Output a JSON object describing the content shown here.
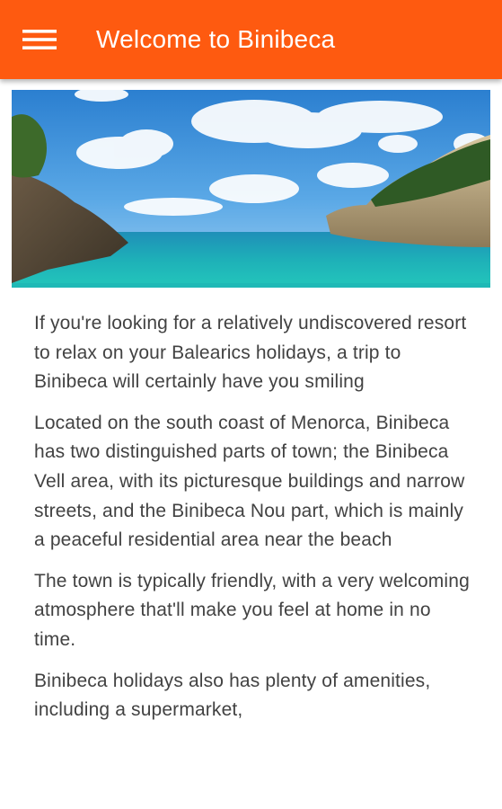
{
  "appbar": {
    "title": "Welcome to Binibeca",
    "menu_icon": "hamburger-menu-icon",
    "background": "#fe5a10"
  },
  "hero": {
    "image": "coastal-cove-photo"
  },
  "article": {
    "paragraphs": [
      "If you're looking for a relatively undiscovered resort to relax on your Balearics holidays, a trip to Binibeca will certainly have you smiling",
      "Located on the south coast of Menorca, Binibeca has two distinguished parts of town; the Binibeca Vell area, with its picturesque buildings and narrow streets, and the Binibeca Nou part, which is mainly a peaceful residential area near the beach",
      "The town is typically friendly, with a very welcoming atmosphere that'll make you feel at home in no time.",
      "Binibeca holidays also has plenty of amenities, including a supermarket,"
    ]
  }
}
